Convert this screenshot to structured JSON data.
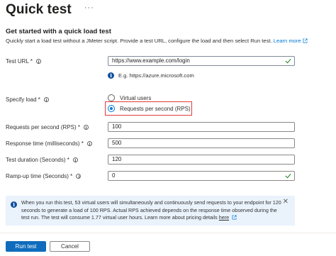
{
  "header": {
    "title": "Quick test",
    "more_label": "···"
  },
  "intro": {
    "heading": "Get started with a quick load test",
    "description": "Quickly start a load test without a JMeter script. Provide a test URL, configure the load and then select Run test.",
    "learn_more": "Learn more"
  },
  "test_url": {
    "label": "Test URL *",
    "value": "https://www.example.com/login",
    "hint": "E.g. https://azure.microsoft.com"
  },
  "specify_load": {
    "label": "Specify load *",
    "options": [
      {
        "label": "Virtual users",
        "selected": false
      },
      {
        "label": "Requests per second (RPS)",
        "selected": true
      }
    ]
  },
  "fields": [
    {
      "label": "Requests per second (RPS) *",
      "value": "100"
    },
    {
      "label": "Response time (milliseconds) *",
      "value": "500"
    },
    {
      "label": "Test duration (Seconds) *",
      "value": "120"
    },
    {
      "label": "Ramp-up time (Seconds) *",
      "value": "0"
    }
  ],
  "banner": {
    "text": "When you run this test, 53 virtual users will simultaneously and continuously send requests to your endpoint for 120 seconds to generate a load of 100 RPS. Actual RPS achieved depends on the response time observed during the test run. The test will consume 1.77 virtual user hours. Learn more about pricing details",
    "link": "here",
    "close": "✕"
  },
  "buttons": {
    "run": "Run test",
    "cancel": "Cancel"
  },
  "colors": {
    "accent": "#0f6cbd",
    "highlight": "#e03b3b",
    "banner_bg": "#eaf3fc",
    "check": "#107c10"
  }
}
